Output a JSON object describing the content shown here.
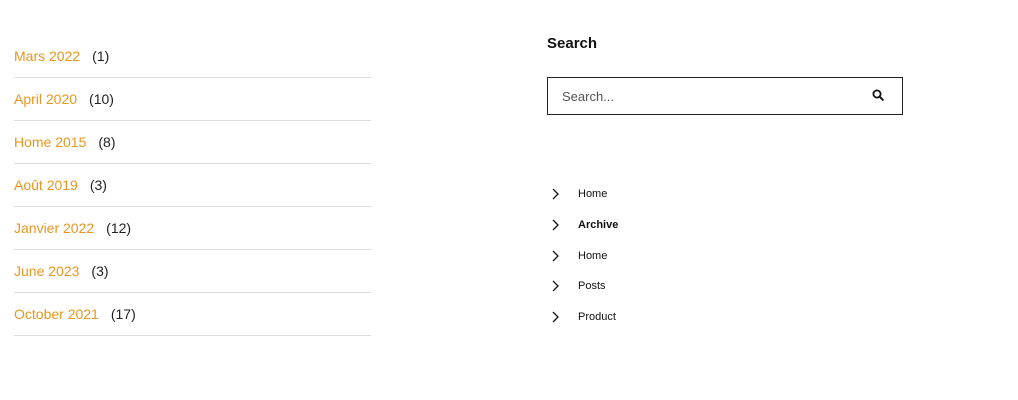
{
  "archives": [
    {
      "label": "Mars 2022",
      "count": "(1)"
    },
    {
      "label": "April 2020",
      "count": "(10)"
    },
    {
      "label": "Home 2015",
      "count": "(8)"
    },
    {
      "label": "Août 2019",
      "count": "(3)"
    },
    {
      "label": "Janvier 2022",
      "count": "(12)"
    },
    {
      "label": "June 2023",
      "count": "(3)"
    },
    {
      "label": "October 2021",
      "count": "(17)"
    }
  ],
  "search": {
    "title": "Search",
    "placeholder": "Search...",
    "button_icon": "search-icon"
  },
  "nav": {
    "items": [
      {
        "label": "Home",
        "active": false,
        "icon": "chevron-right-icon"
      },
      {
        "label": "Archive",
        "active": true,
        "icon": "chevron-right-icon"
      },
      {
        "label": "Home",
        "active": false,
        "icon": "chevron-right-icon"
      },
      {
        "label": "Posts",
        "active": false,
        "icon": "chevron-right-icon"
      },
      {
        "label": "Product",
        "active": false,
        "icon": "chevron-right-icon"
      }
    ]
  },
  "colors": {
    "link": "#e8961e",
    "text": "#222222",
    "divider": "#dddddd"
  }
}
